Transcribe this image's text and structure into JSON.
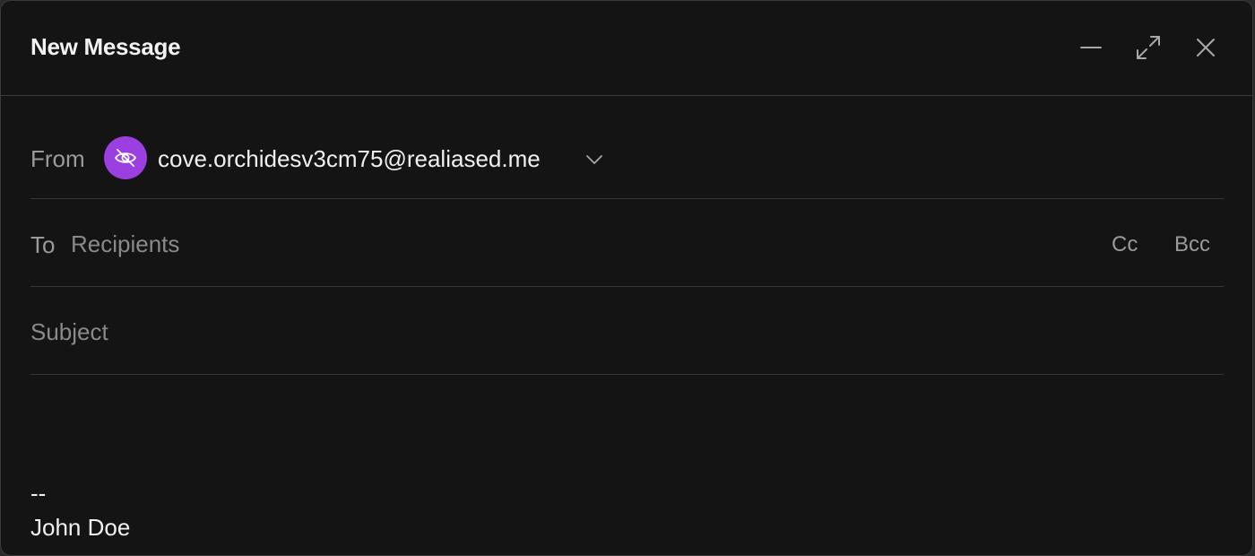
{
  "window": {
    "title": "New Message",
    "controls": {
      "minimize_icon": "minimize-icon",
      "expand_icon": "expand-icon",
      "close_icon": "close-icon"
    }
  },
  "from": {
    "label": "From",
    "avatar_icon": "eye-off-icon",
    "avatar_color": "#9b3fe0",
    "address": "cove.orchidesv3cm75@realiased.me",
    "dropdown_icon": "chevron-down-icon"
  },
  "to": {
    "label": "To",
    "placeholder": "Recipients",
    "value": "",
    "cc_label": "Cc",
    "bcc_label": "Bcc"
  },
  "subject": {
    "placeholder": "Subject",
    "value": ""
  },
  "body": {
    "signature_separator": "--",
    "signature_name": "John Doe"
  }
}
